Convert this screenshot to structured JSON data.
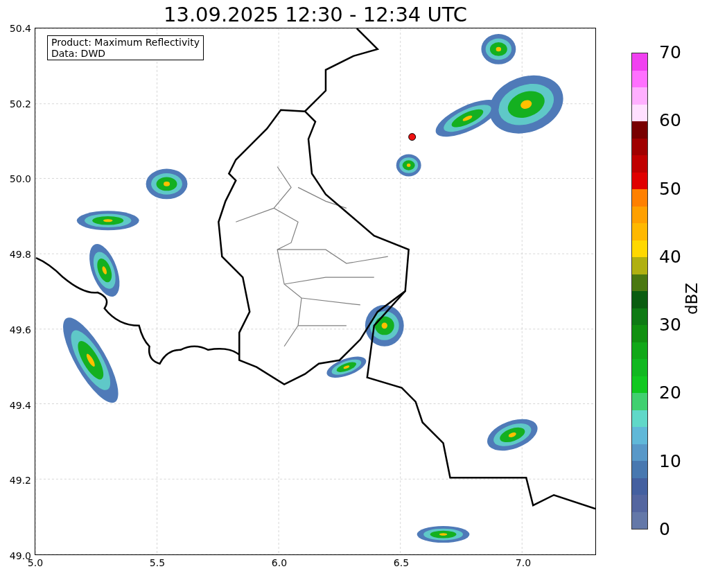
{
  "title": "13.09.2025 12:30 - 12:34 UTC",
  "map": {
    "info_lines": [
      "Product: Maximum Reflectivity",
      "Data: DWD"
    ],
    "xticks": [
      "5.0",
      "5.5",
      "6.0",
      "6.5",
      "7.0"
    ],
    "yticks": [
      "50.4",
      "50.2",
      "50.0",
      "49.8",
      "49.6",
      "49.4",
      "49.2",
      "49.0"
    ]
  },
  "colorbar": {
    "label": "dBZ",
    "ticks": [
      "70",
      "60",
      "50",
      "40",
      "30",
      "20",
      "10",
      "0"
    ],
    "bins": [
      {
        "color": "#f040f0"
      },
      {
        "color": "#ff70ff"
      },
      {
        "color": "#ffb0ff"
      },
      {
        "color": "#ffe0ff"
      },
      {
        "color": "#780000"
      },
      {
        "color": "#a00000"
      },
      {
        "color": "#c00000"
      },
      {
        "color": "#e00000"
      },
      {
        "color": "#ff8000"
      },
      {
        "color": "#ffa000"
      },
      {
        "color": "#ffb800"
      },
      {
        "color": "#ffd800"
      },
      {
        "color": "#b0b010"
      },
      {
        "color": "#4a7810"
      },
      {
        "color": "#0a5c10"
      },
      {
        "color": "#0e7a14"
      },
      {
        "color": "#109010"
      },
      {
        "color": "#10a818"
      },
      {
        "color": "#10b820"
      },
      {
        "color": "#10c820"
      },
      {
        "color": "#40d070"
      },
      {
        "color": "#60d8c8"
      },
      {
        "color": "#60b8d8"
      },
      {
        "color": "#5898c8"
      },
      {
        "color": "#4878b0"
      },
      {
        "color": "#4460a0"
      },
      {
        "color": "#5466a0"
      },
      {
        "color": "#6478a8"
      }
    ]
  }
}
